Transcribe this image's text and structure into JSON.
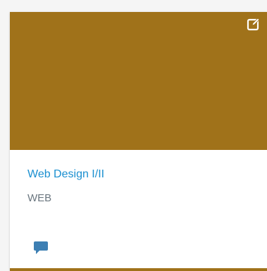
{
  "card": {
    "title": "Web Design I/II",
    "code": "WEB",
    "color": "#a0721a"
  },
  "icons": {
    "edit": "edit-icon",
    "comment": "comment-icon"
  },
  "colors": {
    "title_link": "#1a8fd0",
    "code_text": "#6b7780",
    "comment_icon": "#3d7fb3"
  }
}
